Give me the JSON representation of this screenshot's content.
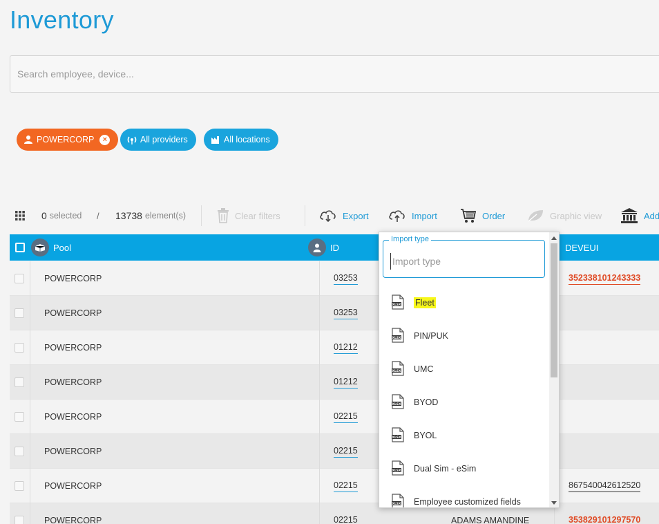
{
  "page": {
    "title": "Inventory"
  },
  "search": {
    "placeholder": "Search employee, device..."
  },
  "filters": {
    "org": "POWERCORP",
    "providers": "All providers",
    "locations": "All locations"
  },
  "toolbar": {
    "selected_count": "0",
    "selected_label": "selected",
    "divider": "/",
    "total_count": "13738",
    "elements_label": "element(s)",
    "clear_filters": "Clear filters",
    "export": "Export",
    "import": "Import",
    "order": "Order",
    "graphic_view": "Graphic view",
    "add": "Add"
  },
  "table": {
    "headers": {
      "pool": "Pool",
      "id": "ID",
      "deveui": "DEVEUI"
    },
    "rows": [
      {
        "pool": "POWERCORP",
        "id": "03253",
        "name": "",
        "deveui": "352338101243333",
        "deveui_red": true
      },
      {
        "pool": "POWERCORP",
        "id": "03253",
        "name": "",
        "deveui": "",
        "deveui_red": false
      },
      {
        "pool": "POWERCORP",
        "id": "01212",
        "name": "",
        "deveui": "",
        "deveui_red": false
      },
      {
        "pool": "POWERCORP",
        "id": "01212",
        "name": "",
        "deveui": "",
        "deveui_red": false
      },
      {
        "pool": "POWERCORP",
        "id": "02215",
        "name": "",
        "deveui": "",
        "deveui_red": false
      },
      {
        "pool": "POWERCORP",
        "id": "02215",
        "name": "",
        "deveui": "",
        "deveui_red": false
      },
      {
        "pool": "POWERCORP",
        "id": "02215",
        "name": "",
        "deveui": "867540042612520",
        "deveui_red": false
      },
      {
        "pool": "POWERCORP",
        "id": "02215",
        "name": "ADAMS AMANDINE",
        "deveui": "353829101297570",
        "deveui_red": true
      }
    ]
  },
  "import_dropdown": {
    "label": "Import type",
    "placeholder": "Import type",
    "items": [
      {
        "label": "Fleet",
        "highlighted": true
      },
      {
        "label": "PIN/PUK",
        "highlighted": false
      },
      {
        "label": "UMC",
        "highlighted": false
      },
      {
        "label": "BYOD",
        "highlighted": false
      },
      {
        "label": "BYOL",
        "highlighted": false
      },
      {
        "label": "Dual Sim - eSim",
        "highlighted": false
      },
      {
        "label": "Employee customized fields",
        "highlighted": false
      }
    ]
  },
  "colors": {
    "accent": "#1e9ad6",
    "header_bg": "#08a4e2",
    "org_chip": "#f26722",
    "alert_red": "#e04b26",
    "highlight": "#f7f71a"
  }
}
